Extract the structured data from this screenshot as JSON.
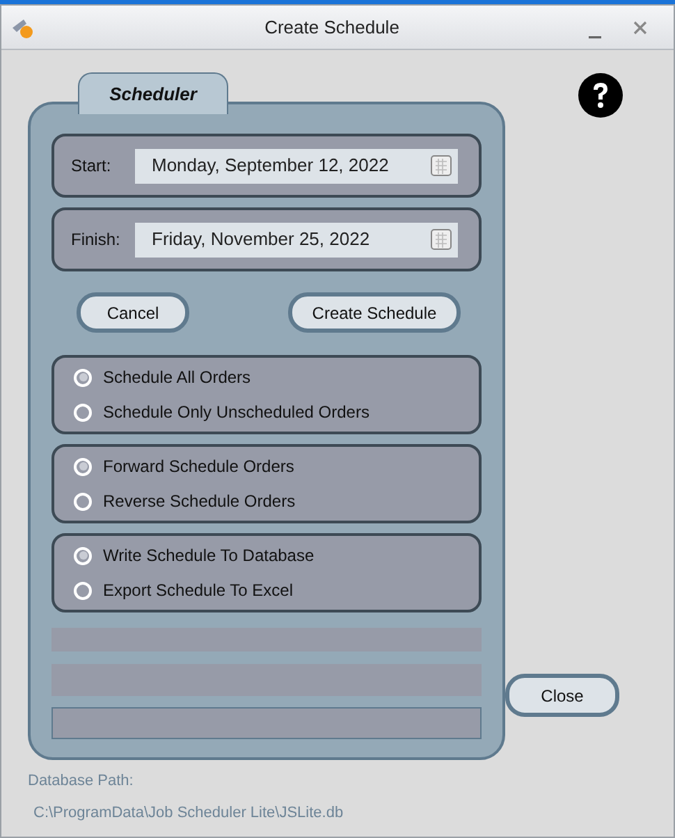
{
  "window": {
    "title": "Create Schedule"
  },
  "tab": {
    "label": "Scheduler"
  },
  "dates": [
    {
      "label": "Start:",
      "value": "Monday, September 12, 2022"
    },
    {
      "label": "Finish:",
      "value": "Friday, November 25, 2022"
    }
  ],
  "buttons": [
    {
      "label": "Cancel"
    },
    {
      "label": "Create Schedule"
    }
  ],
  "radio_groups": [
    [
      {
        "label": "Schedule All Orders",
        "selected": true
      },
      {
        "label": "Schedule Only Unscheduled Orders",
        "selected": false
      }
    ],
    [
      {
        "label": "Forward Schedule Orders",
        "selected": true
      },
      {
        "label": "Reverse Schedule Orders",
        "selected": false
      }
    ],
    [
      {
        "label": "Write Schedule To Database",
        "selected": true
      },
      {
        "label": "Export Schedule To Excel",
        "selected": false
      }
    ]
  ],
  "close_button": {
    "label": "Close"
  },
  "database_path": {
    "label": "Database Path:",
    "value": "C:\\ProgramData\\Job Scheduler Lite\\JSLite.db"
  }
}
